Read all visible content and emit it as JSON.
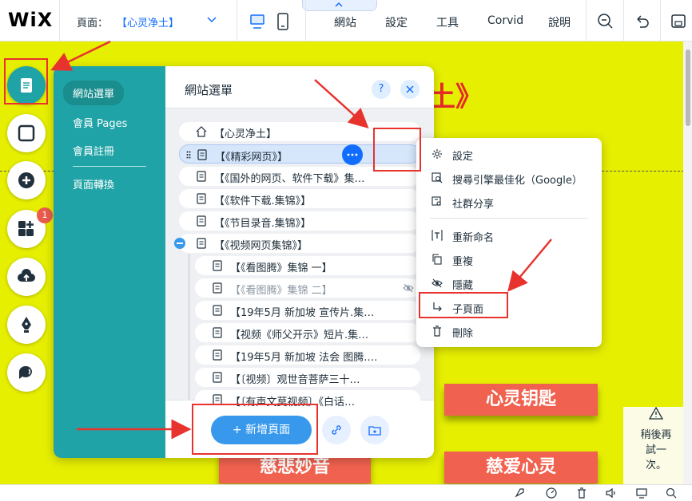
{
  "topbar": {
    "logo": "WiX",
    "page_label": "頁面：",
    "page_value": "【心灵净土】",
    "menu": {
      "site": "網站",
      "settings": "設定",
      "tools": "工具",
      "corvid": "Corvid",
      "help": "說明"
    }
  },
  "canvas": {
    "site_title": "土》",
    "banners": [
      "心灵钥匙",
      "慈悲妙音",
      "慈爱心灵"
    ],
    "notice": "稍後再試一次。"
  },
  "left_toolbar": {
    "badge": "1"
  },
  "panel": {
    "nav": {
      "site_menu": "網站選單",
      "member_pages": "會員 Pages",
      "member_signup": "會員註冊",
      "page_transitions": "頁面轉換"
    },
    "title": "網站選單",
    "help_label": "?",
    "pages": [
      {
        "label": "【心灵净土】",
        "icon": "home-icon"
      },
      {
        "label": "【《精彩网页》】",
        "icon": "page-icon",
        "selected": true
      },
      {
        "label": "【《国外的网页、软件下载》集…",
        "icon": "page-icon"
      },
      {
        "label": "【《软件下载.集锦》】",
        "icon": "page-icon"
      },
      {
        "label": "【《节目录音.集锦》】",
        "icon": "page-icon"
      },
      {
        "label": "【《视频网页集锦》】",
        "icon": "page-icon",
        "expanded": true
      },
      {
        "label": "【《看图腾》集锦 一】",
        "icon": "page-icon",
        "child": true
      },
      {
        "label": "【《看图腾》集锦 二】",
        "icon": "page-icon",
        "child": true,
        "hidden": true
      },
      {
        "label": "【19年5月 新加坡 宣传片.集…",
        "icon": "page-icon",
        "child": true
      },
      {
        "label": "【视频《师父开示》短片.集…",
        "icon": "page-icon",
        "child": true
      },
      {
        "label": "【19年5月 新加坡 法会 图腾.…",
        "icon": "page-icon",
        "child": true
      },
      {
        "label": "【〔视频〕观世音菩萨三十…",
        "icon": "page-icon",
        "child": true
      },
      {
        "label": "【〔有声文莫视频〕《白话…",
        "icon": "page-icon",
        "child": true
      }
    ],
    "add_page": "+ 新增頁面"
  },
  "context_menu": {
    "items": [
      {
        "label": "設定",
        "icon": "gear-icon"
      },
      {
        "label": "搜尋引擎最佳化（Google）",
        "icon": "seo-icon"
      },
      {
        "label": "社群分享",
        "icon": "social-share-icon"
      },
      {
        "label": "重新命名",
        "icon": "rename-icon"
      },
      {
        "label": "重複",
        "icon": "duplicate-icon"
      },
      {
        "label": "隱藏",
        "icon": "eye-icon"
      },
      {
        "label": "子頁面",
        "icon": "subpage-icon"
      },
      {
        "label": "刪除",
        "icon": "trash-icon"
      }
    ]
  },
  "colors": {
    "canvas_bg": "#e6ef00",
    "panel_side": "#20a3a6",
    "accent_blue": "#116dff",
    "banner": "#f0624f",
    "annotation_red": "#e8322e"
  }
}
